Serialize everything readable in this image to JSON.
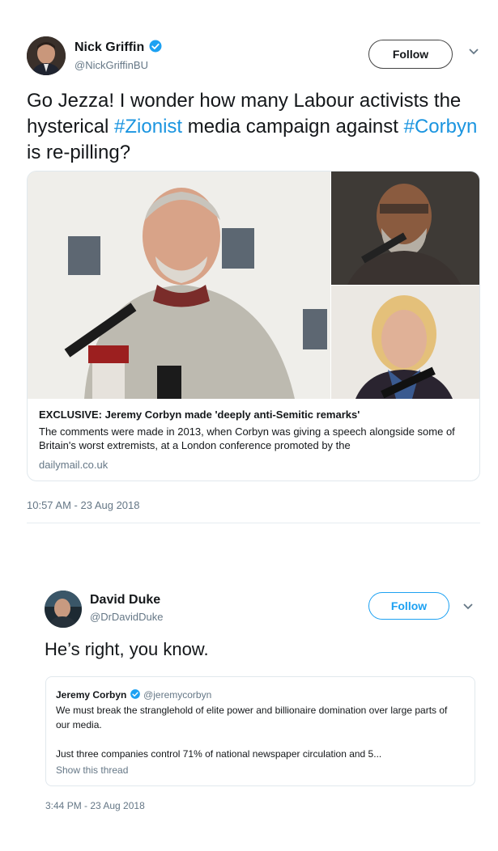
{
  "tweet1": {
    "name": "Nick Griffin",
    "handle": "@NickGriffinBU",
    "follow_label": "Follow",
    "text_parts": [
      "Go Jezza! I wonder how many Labour activists the hysterical ",
      "#Zionist",
      " media campaign against ",
      "#Corbyn",
      " is re-pilling?"
    ],
    "card": {
      "title": "EXCLUSIVE: Jeremy Corbyn made 'deeply anti-Semitic remarks'",
      "description": "The comments were made in 2013, when Corbyn was giving a speech alongside some of Britain's worst extremists, at a London conference promoted by the",
      "domain": "dailymail.co.uk"
    },
    "timestamp": "10:57 AM - 23 Aug 2018"
  },
  "tweet2": {
    "name": "David Duke",
    "handle": "@DrDavidDuke",
    "follow_label": "Follow",
    "text": "He’s right, you know.",
    "quote": {
      "name": "Jeremy Corbyn",
      "handle": "@jeremycorbyn",
      "line1": "We must break the stranglehold of elite power and billionaire domination over large parts of our media.",
      "line2": "Just three companies control 71% of national newspaper circulation and 5...",
      "show_thread": "Show this thread"
    },
    "timestamp": "3:44 PM - 23 Aug 2018"
  },
  "colors": {
    "accent": "#1da1f2",
    "hashtag": "#1b95e0",
    "muted": "#657786",
    "border": "#e1e8ed"
  },
  "icons": [
    "verified-badge-icon",
    "chevron-down-icon"
  ]
}
